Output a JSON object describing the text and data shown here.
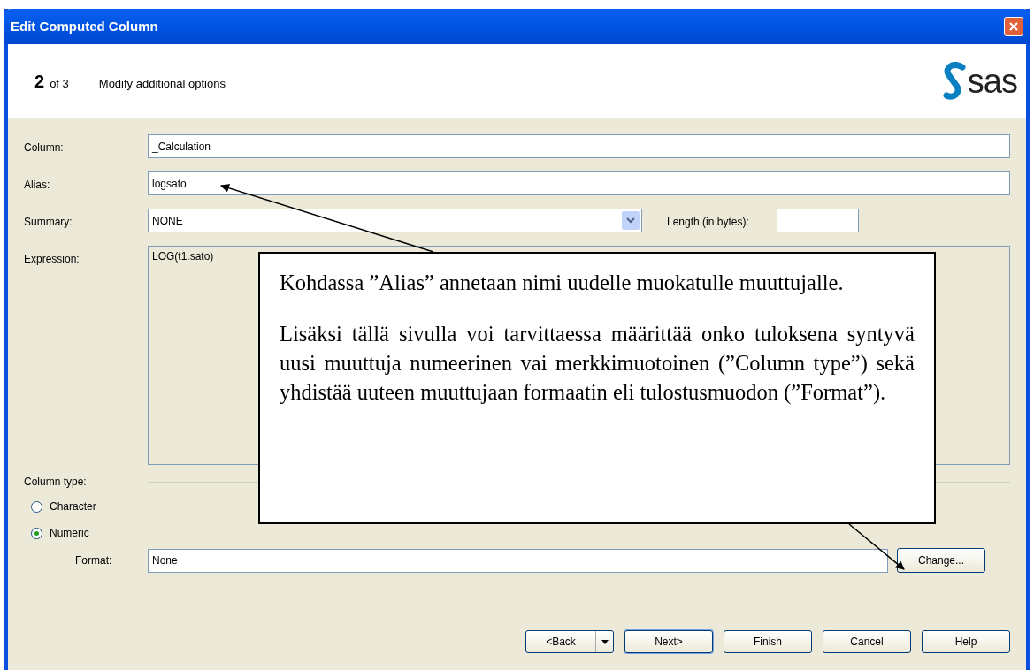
{
  "window": {
    "title": "Edit Computed Column"
  },
  "header": {
    "step": "2",
    "step_total": "of 3",
    "subtitle": "Modify additional options",
    "logo": "sas"
  },
  "fields": [
    {
      "label": "Column:",
      "value": "_Calculation",
      "kind": "text"
    },
    {
      "label": "Alias:",
      "value": "logsato",
      "kind": "text"
    },
    {
      "label": "Summary:",
      "value": "NONE",
      "kind": "dropdown",
      "extra_label": "Length (in bytes):"
    },
    {
      "label": "Expression:",
      "value": "LOG(t1.sato)",
      "kind": "area"
    }
  ],
  "column_type": {
    "label": "Column type:",
    "options": [
      {
        "label": "Character",
        "selected": false
      },
      {
        "label": "Numeric",
        "selected": true
      }
    ]
  },
  "format": {
    "label": "Format:",
    "value": "None",
    "button": "Change..."
  },
  "buttons": [
    {
      "label": "<Back",
      "kind": "split",
      "default": false
    },
    {
      "label": "Next>",
      "kind": "plain",
      "default": true
    },
    {
      "label": "Finish",
      "kind": "plain",
      "default": false
    },
    {
      "label": "Cancel",
      "kind": "plain",
      "default": false
    },
    {
      "label": "Help",
      "kind": "plain",
      "default": false
    }
  ],
  "callout": {
    "paragraphs": [
      "Kohdassa ”Alias” annetaan nimi uudelle muokatulle muuttujalle.",
      "Lisäksi tällä sivulla voi tarvittaessa määrittää onko tuloksena syntyvä uusi muuttuja numeerinen vai merkkimuotoinen (”Column type”) sekä yhdistää uuteen muuttujaan formaatin eli tulostusmuodon (”Format”)."
    ]
  }
}
